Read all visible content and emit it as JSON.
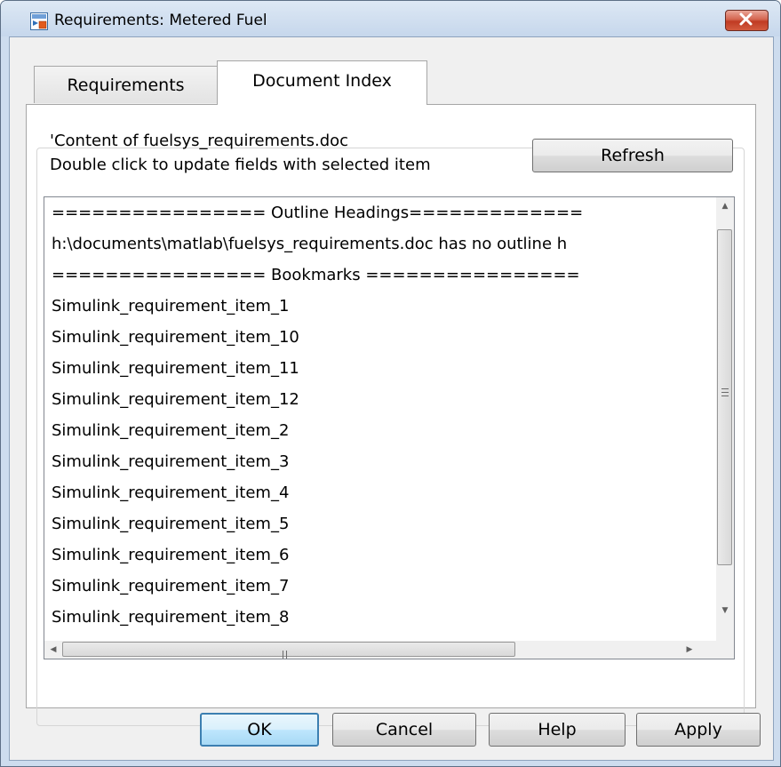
{
  "window": {
    "title": "Requirements: Metered Fuel",
    "accent_color": "#c6d7ec",
    "close_button_color": "#c8452f"
  },
  "tabs": [
    {
      "label": "Requirements",
      "active": false
    },
    {
      "label": "Document Index",
      "active": true
    }
  ],
  "panel": {
    "info_line_1": "'Content of fuelsys_requirements.doc",
    "info_line_2": "Double click to update fields with selected item",
    "refresh_label": "Refresh"
  },
  "list": {
    "items": [
      "================ Outline Headings=============",
      "h:\\documents\\matlab\\fuelsys_requirements.doc has no outline h",
      "================ Bookmarks ================",
      "Simulink_requirement_item_1",
      "Simulink_requirement_item_10",
      "Simulink_requirement_item_11",
      "Simulink_requirement_item_12",
      "Simulink_requirement_item_2",
      "Simulink_requirement_item_3",
      "Simulink_requirement_item_4",
      "Simulink_requirement_item_5",
      "Simulink_requirement_item_6",
      "Simulink_requirement_item_7",
      "Simulink_requirement_item_8"
    ],
    "icons": {
      "scroll_up": "scroll-up-arrow-icon",
      "scroll_down": "scroll-down-arrow-icon",
      "scroll_left": "scroll-left-arrow-icon",
      "scroll_right": "scroll-right-arrow-icon"
    }
  },
  "buttons": {
    "ok": "OK",
    "cancel": "Cancel",
    "help": "Help",
    "apply": "Apply"
  }
}
